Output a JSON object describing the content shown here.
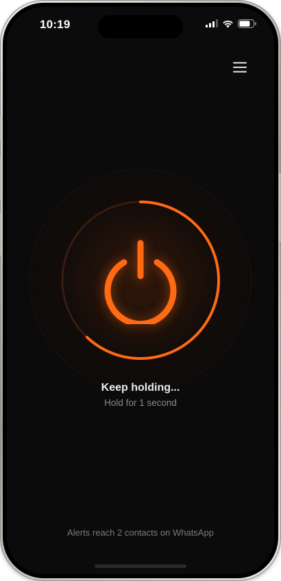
{
  "status_bar": {
    "time": "10:19",
    "icons": [
      "signal-icon",
      "wifi-icon",
      "battery-icon"
    ]
  },
  "header": {
    "menu_icon": "hamburger-menu-icon"
  },
  "power_control": {
    "icon": "power-icon",
    "hold_progress": 0.62,
    "accent_color": "#ff6a13"
  },
  "status": {
    "title": "Keep holding...",
    "subtitle": "Hold for 1 second"
  },
  "footer": {
    "note": "Alerts reach 2 contacts on WhatsApp"
  },
  "colors": {
    "background": "#0b0b0b",
    "accent": "#ff6a13",
    "text_primary": "#ececec",
    "text_secondary": "#8a8a8a"
  }
}
